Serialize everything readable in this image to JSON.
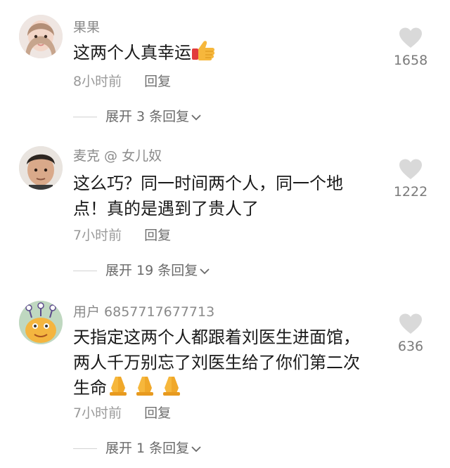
{
  "comments": [
    {
      "username": "果果",
      "text": "这两个人真幸运",
      "emoji": "thumbs-up",
      "time": "8小时前",
      "reply_label": "回复",
      "likes": "1658",
      "expand_label": "展开 3 条回复"
    },
    {
      "username": "麦克 @ 女儿奴",
      "text_line1": "这么巧？同一时间两个人，同一个地",
      "text_line2": "点！真的是遇到了贵人了",
      "time": "7小时前",
      "reply_label": "回复",
      "likes": "1222",
      "expand_label": "展开 19 条回复"
    },
    {
      "username": "用户 6857717677713",
      "text_line1": "天指定这两个人都跟着刘医生进面馆，",
      "text_line2": "两人千万别忘了刘医生给了你们第二次",
      "text_line3": "生命",
      "emoji": "folded-hands",
      "time": "7小时前",
      "reply_label": "回复",
      "likes": "636",
      "expand_label": "展开 1 条回复"
    }
  ],
  "colors": {
    "text": "#1a1a1a",
    "username": "#8a8a8a",
    "meta": "#9a9a9a",
    "heart": "#d9d9d9"
  }
}
